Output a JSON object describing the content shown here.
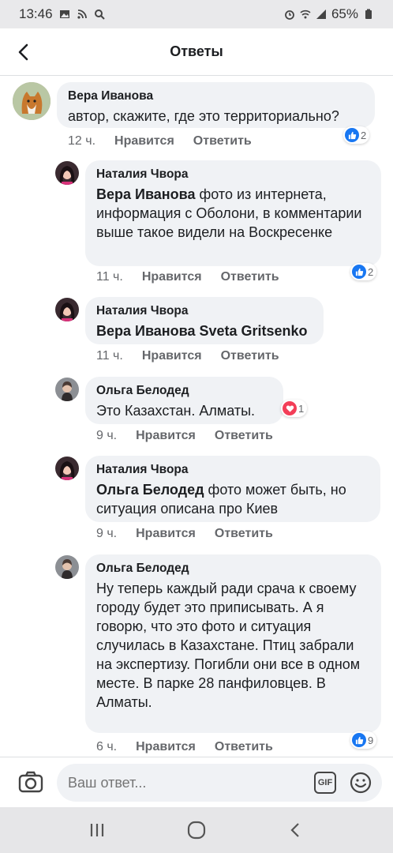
{
  "status_bar": {
    "time": "13:46",
    "battery": "65%"
  },
  "header": {
    "title": "Ответы"
  },
  "comments": [
    {
      "author": "Вера Иванова",
      "mention": "",
      "text": "автор, скажите, где это территориально?",
      "time": "12 ч.",
      "like_label": "Нравится",
      "reply_label": "Ответить",
      "reaction": "like",
      "reaction_count": "2"
    },
    {
      "author": "Наталия Чвора",
      "mention": "Вера Иванова",
      "text": " фото из интернета, информация с Оболони, в комментарии выше такое видели на Воскресенке",
      "time": "11 ч.",
      "like_label": "Нравится",
      "reply_label": "Ответить",
      "reaction": "like",
      "reaction_count": "2"
    },
    {
      "author": "Наталия Чвора",
      "mention": "Вера Иванова Sveta Gritsenko",
      "text": "",
      "time": "11 ч.",
      "like_label": "Нравится",
      "reply_label": "Ответить"
    },
    {
      "author": "Ольга Белодед",
      "mention": "",
      "text": "Это Казахстан. Алматы.",
      "time": "9 ч.",
      "like_label": "Нравится",
      "reply_label": "Ответить",
      "reaction": "love",
      "reaction_count": "1"
    },
    {
      "author": "Наталия Чвора",
      "mention": "Ольга Белодед",
      "text": " фото может быть, но ситуация описана про Киев",
      "time": "9 ч.",
      "like_label": "Нравится",
      "reply_label": "Ответить"
    },
    {
      "author": "Ольга Белодед",
      "mention": "",
      "text": "Ну теперь каждый ради срача к своему городу будет это приписывать. А я говорю, что это фото и ситуация случилась в Казахстане. Птиц забрали на экспертизу. Погибли они все в одном месте. В парке 28 панфиловцев. В Алматы.",
      "time": "6 ч.",
      "like_label": "Нравится",
      "reply_label": "Ответить",
      "reaction": "like",
      "reaction_count": "9"
    }
  ],
  "reply_bar": {
    "placeholder": "Ваш ответ...",
    "gif_label": "GIF"
  },
  "colors": {
    "like_blue": "#1877f2",
    "love_red": "#f33e58",
    "bubble": "#f0f2f5",
    "meta_gray": "#65676b"
  }
}
